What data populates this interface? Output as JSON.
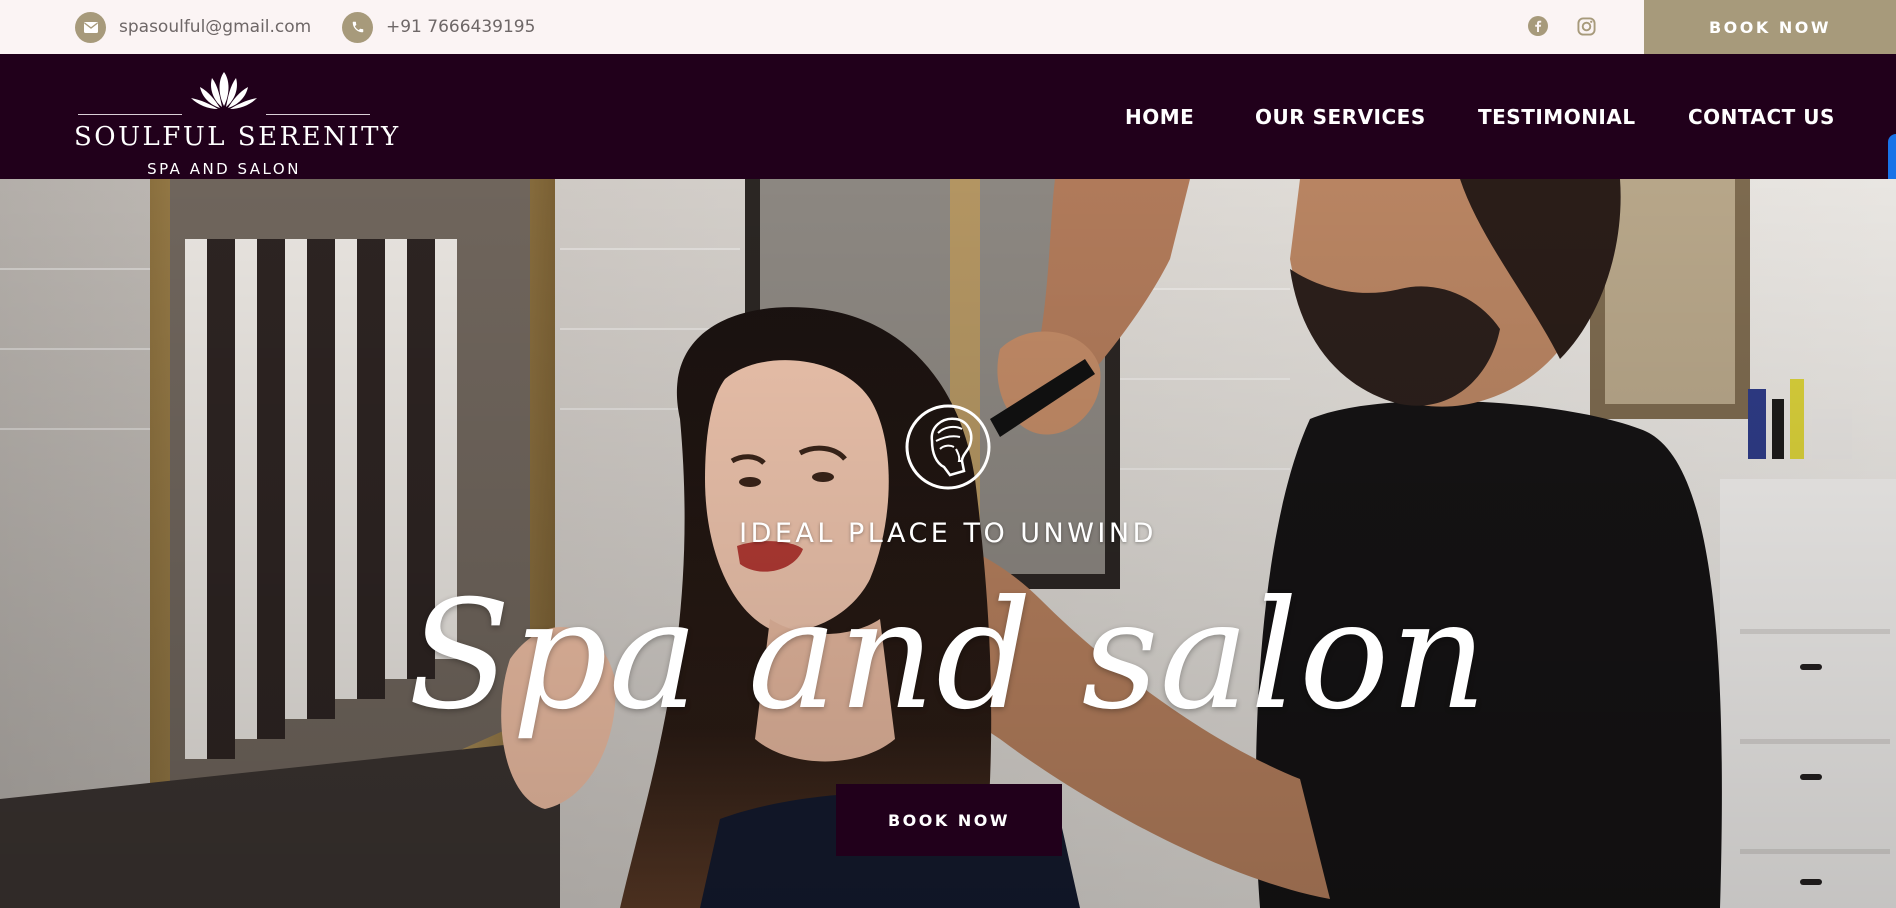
{
  "topbar": {
    "email": "spasoulful@gmail.com",
    "phone": "+91 7666439195",
    "social": [
      "facebook-icon",
      "instagram-icon"
    ],
    "book_label": "BOOK NOW"
  },
  "header": {
    "logo_name": "SOULFUL SERENITY",
    "logo_sub": "SPA AND SALON",
    "nav": [
      "HOME",
      "OUR SERVICES",
      "TESTIMONIAL",
      "CONTACT US"
    ]
  },
  "hero": {
    "tagline": "IDEAL PLACE TO UNWIND",
    "title": "Spa and salon",
    "book_label": "BOOK NOW"
  },
  "colors": {
    "topbar_bg": "#fbf4f4",
    "header_bg": "#21001b",
    "accent_gold": "#a79a7b",
    "text_muted": "#6e6767"
  }
}
